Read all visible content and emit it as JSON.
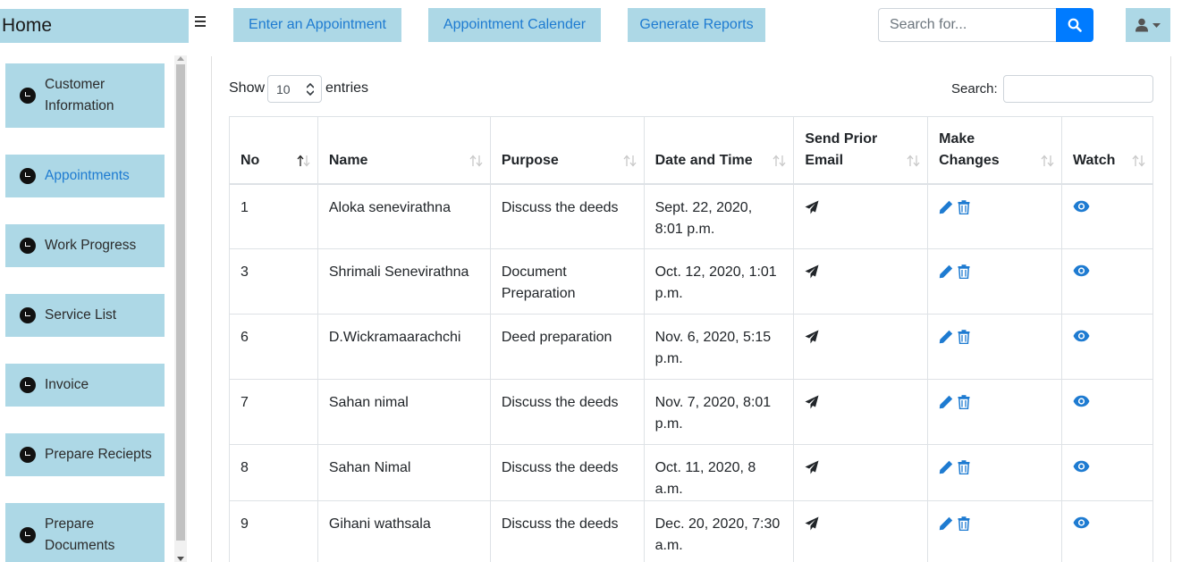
{
  "navbar": {
    "brand": "Home",
    "buttons": [
      "Enter an Appointment",
      "Appointment Calender",
      "Generate Reports"
    ],
    "search_placeholder": "Search for..."
  },
  "sidebar": {
    "items": [
      {
        "label": "Customer Information",
        "active": false
      },
      {
        "label": "Appointments",
        "active": true
      },
      {
        "label": "Work Progress",
        "active": false
      },
      {
        "label": "Service List",
        "active": false
      },
      {
        "label": "Invoice",
        "active": false
      },
      {
        "label": "Prepare Reciepts",
        "active": false
      },
      {
        "label": "Prepare Documents",
        "active": false
      }
    ]
  },
  "table_controls": {
    "show_label": "Show",
    "page_length": "10",
    "entries_label": "entries",
    "search_label": "Search:"
  },
  "table": {
    "columns": [
      "No",
      "Name",
      "Purpose",
      "Date and Time",
      "Send Prior Email",
      "Make Changes",
      "Watch"
    ],
    "rows": [
      {
        "no": "1",
        "name": "Aloka senevirathna",
        "purpose": "Discuss the deeds",
        "datetime": "Sept. 22, 2020, 8:01 p.m."
      },
      {
        "no": "3",
        "name": "Shrimali Senevirathna",
        "purpose": "Document Preparation",
        "datetime": "Oct. 12, 2020, 1:01 p.m."
      },
      {
        "no": "6",
        "name": "D.Wickramaarachchi",
        "purpose": "Deed preparation",
        "datetime": "Nov. 6, 2020, 5:15 p.m."
      },
      {
        "no": "7",
        "name": "Sahan nimal",
        "purpose": "Discuss the deeds",
        "datetime": "Nov. 7, 2020, 8:01 p.m."
      },
      {
        "no": "8",
        "name": "Sahan Nimal",
        "purpose": "Discuss the deeds",
        "datetime": "Oct. 11, 2020, 8 a.m."
      },
      {
        "no": "9",
        "name": "Gihani wathsala",
        "purpose": "Discuss the deeds",
        "datetime": "Dec. 20, 2020, 7:30 a.m."
      }
    ]
  },
  "icons": {
    "send": "paper-plane-icon",
    "edit": "pencil-icon",
    "delete": "trash-icon",
    "watch": "eye-icon",
    "sidebar": "clock-icon",
    "search": "search-icon",
    "user": "user-icon"
  },
  "colors": {
    "accent": "#add8e6",
    "link": "#1e7bd1",
    "primary": "#007bff"
  }
}
